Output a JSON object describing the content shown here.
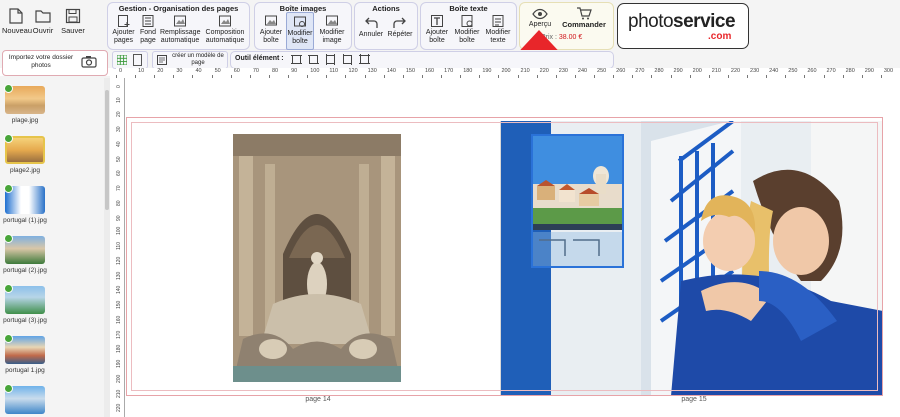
{
  "file_menu": [
    {
      "label": "Nouveau",
      "icon": "new-file-icon"
    },
    {
      "label": "Ouvrir",
      "icon": "open-folder-icon"
    },
    {
      "label": "Sauver",
      "icon": "save-icon"
    }
  ],
  "groups": {
    "gestion": {
      "title": "Gestion - Organisation des pages",
      "items": [
        "Ajouter pages",
        "Fond page",
        "Remplissage automatique",
        "Composition automatique"
      ]
    },
    "boite_images": {
      "title": "Boîte images",
      "items": [
        "Ajouter boîte",
        "Modifier boîte",
        "Modifier image"
      ]
    },
    "actions": {
      "title": "Actions",
      "items": [
        "Annuler",
        "Répéter"
      ]
    },
    "boite_texte": {
      "title": "Boîte texte",
      "items": [
        "Ajouter boîte",
        "Modifier boîte",
        "Modifier texte"
      ]
    }
  },
  "order": {
    "apercu": "Aperçu",
    "commander": "Commander",
    "price_label": "Prix :",
    "price_value": "38.00 €"
  },
  "logo": {
    "text_light": "photo",
    "text_bold": "service",
    "suffix": ".com"
  },
  "secondary_bar": {
    "import_label": "Importez votre dossier photos",
    "template_label": "créer un modèle de page",
    "outil_label": "Outil élément :"
  },
  "photos": [
    {
      "name": "plage.jpg"
    },
    {
      "name": "plage2.jpg"
    },
    {
      "name": "portugal (1).jpg"
    },
    {
      "name": "portugal (2).jpg"
    },
    {
      "name": "portugal (3).jpg"
    },
    {
      "name": "portugal 1.jpg"
    },
    {
      "name": ""
    }
  ],
  "ruler_ticks": [
    0,
    10,
    20,
    30,
    40,
    50,
    60,
    70,
    80,
    90,
    100,
    110,
    120,
    130,
    140,
    150,
    160,
    170,
    180,
    190,
    200,
    210,
    220,
    230,
    240,
    250,
    260,
    270,
    280,
    290,
    200,
    210,
    220,
    230,
    240,
    250,
    260,
    270,
    280,
    290,
    300
  ],
  "ruler_v_ticks": [
    0,
    10,
    20,
    30,
    40,
    50,
    60,
    70,
    80,
    90,
    100,
    110,
    120,
    130,
    140,
    150,
    160,
    170,
    180,
    190,
    200,
    210,
    220
  ],
  "pages": {
    "left_label": "page 14",
    "right_label": "page 15"
  },
  "colors": {
    "accent_red": "#e8262a",
    "price_red": "#d0161c",
    "group_border": "#cfcfe6",
    "guide_red": "#e7a3a8"
  }
}
